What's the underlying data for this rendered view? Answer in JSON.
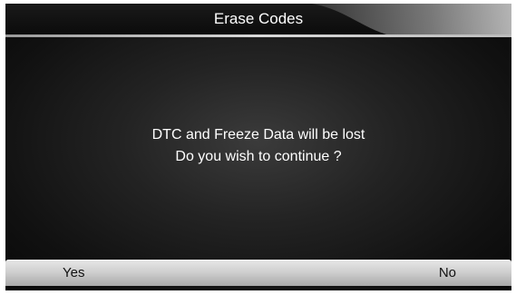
{
  "header": {
    "title": "Erase Codes"
  },
  "dialog": {
    "line1": "DTC and Freeze Data will be lost",
    "line2": "Do you wish to continue ?"
  },
  "buttons": {
    "yes_label": "Yes",
    "no_label": "No"
  },
  "colors": {
    "background": "#1e1e1e",
    "text": "#ffffff",
    "button_bar": "#d0d0d0",
    "button_text": "#111111"
  }
}
